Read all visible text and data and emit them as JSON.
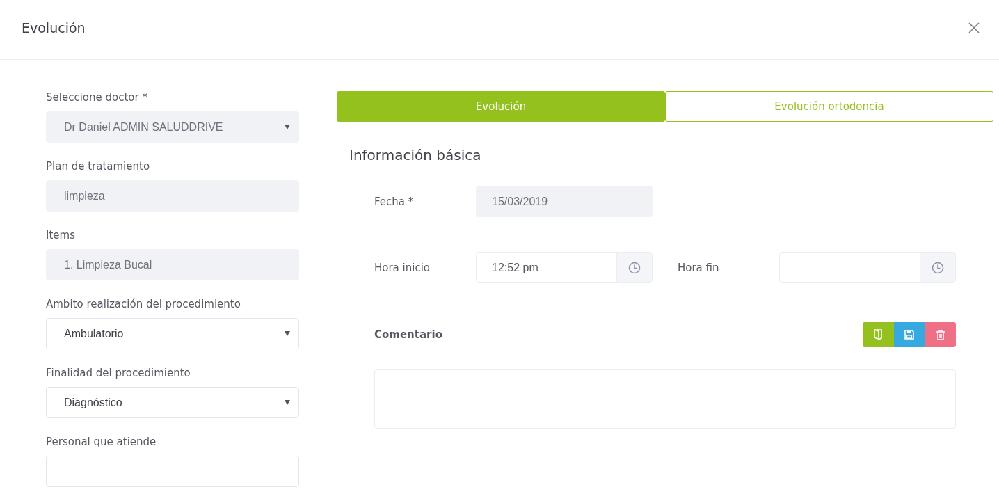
{
  "dialog": {
    "title": "Evolución"
  },
  "left_fields": [
    {
      "label": "Seleccione doctor *",
      "kind": "select",
      "value": "Dr Daniel ADMIN SALUDDRIVE",
      "disabled": true
    },
    {
      "label": "Plan de tratamiento",
      "kind": "text",
      "value": "limpieza",
      "disabled": true
    },
    {
      "label": "Items",
      "kind": "text",
      "value": "1. Limpieza Bucal",
      "disabled": true
    },
    {
      "label": "Ambito realización del procedimiento",
      "kind": "select",
      "value": "Ambulatorio",
      "disabled": false
    },
    {
      "label": "Finalidad del procedimiento",
      "kind": "select",
      "value": "Diagnóstico",
      "disabled": false
    },
    {
      "label": "Personal que atiende",
      "kind": "text",
      "disabled": false
    }
  ],
  "tabs": [
    {
      "label": "Evolución",
      "selected": true
    },
    {
      "label": "Evolución ortodoncia",
      "selected": false
    }
  ],
  "section_title": "Información básica",
  "fecha": {
    "label": "Fecha *",
    "value": "15/03/2019",
    "disabled": true
  },
  "hora_inicio": {
    "label": "Hora inicio",
    "value": "12:52 pm"
  },
  "hora_fin": {
    "label": "Hora fin"
  },
  "comentario": {
    "label": "Comentario"
  },
  "action_buttons": [
    {
      "kind": "book",
      "color": "#95c11f"
    },
    {
      "kind": "save",
      "color": "#36a9e1"
    },
    {
      "kind": "delete",
      "color": "#ef6f87"
    }
  ]
}
